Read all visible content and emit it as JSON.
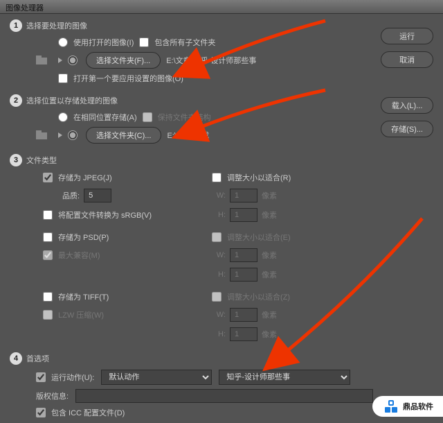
{
  "window": {
    "title": "图像处理器"
  },
  "actions": {
    "run": "运行",
    "cancel": "取消",
    "load": "载入(L)...",
    "save": "存储(S)..."
  },
  "step1": {
    "title": "选择要处理的图像",
    "use_open": "使用打开的图像(I)",
    "include_sub": "包含所有子文件夹",
    "choose_folder": "选择文件夹(F)...",
    "path": "E:\\文章\\知乎-设计师那些事",
    "open_first": "打开第一个要应用设置的图像(O)"
  },
  "step2": {
    "title": "选择位置以存储处理的图像",
    "same_loc": "在相同位置存储(A)",
    "keep_struct": "保持文件夹结构",
    "choose_folder": "选择文件夹(C)...",
    "path": "E:\\文章\\完成"
  },
  "step3": {
    "title": "文件类型",
    "jpeg": "存储为 JPEG(J)",
    "resize_r": "调整大小以适合(R)",
    "quality_lbl": "品质:",
    "quality_val": "5",
    "w": "W:",
    "h": "H:",
    "dim": "1",
    "px": "像素",
    "srgb": "将配置文件转换为 sRGB(V)",
    "psd": "存储为 PSD(P)",
    "resize_e": "调整大小以适合(E)",
    "maxcompat": "最大兼容(M)",
    "tiff": "存储为 TIFF(T)",
    "resize_z": "调整大小以适合(Z)",
    "lzw": "LZW 压缩(W)"
  },
  "step4": {
    "title": "首选项",
    "run_action": "运行动作(U):",
    "action_set": "默认动作",
    "action": "知乎-设计师那些事",
    "copyright_lbl": "版权信息:",
    "copyright_val": "",
    "icc": "包含 ICC 配置文件(D)"
  },
  "watermark": "鼎品软件"
}
